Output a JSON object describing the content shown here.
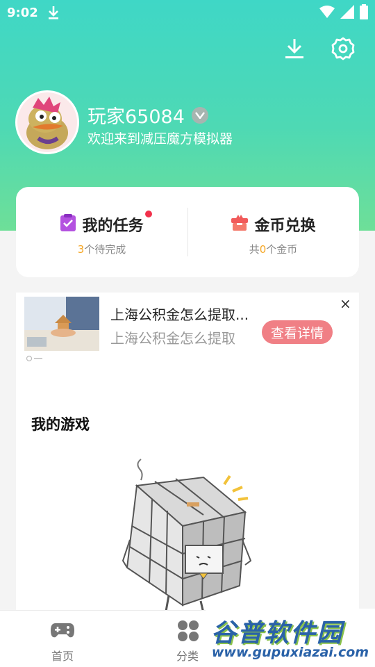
{
  "status_bar": {
    "time": "9:02"
  },
  "profile": {
    "username": "玩家65084",
    "welcome": "欢迎来到减压魔方模拟器"
  },
  "card": {
    "tasks": {
      "title": "我的任务",
      "count": "3",
      "suffix": "个待完成"
    },
    "coins": {
      "title": "金币兑换",
      "prefix": "共",
      "count": "0",
      "suffix": "个金币"
    }
  },
  "ad": {
    "title": "上海公积金怎么提取...",
    "description": "上海公积金怎么提取",
    "button": "查看详情",
    "close": "×"
  },
  "games": {
    "title": "我的游戏"
  },
  "nav": {
    "home": "首页",
    "category": "分类"
  },
  "watermark": {
    "title": "谷普软件园",
    "url": "www.gupuxiazai.com"
  },
  "colors": {
    "header_start": "#3fd7c6",
    "header_end": "#6edf98",
    "accent_orange": "#f5a623",
    "ad_button": "#f07f85",
    "badge_red": "#f2314b"
  }
}
